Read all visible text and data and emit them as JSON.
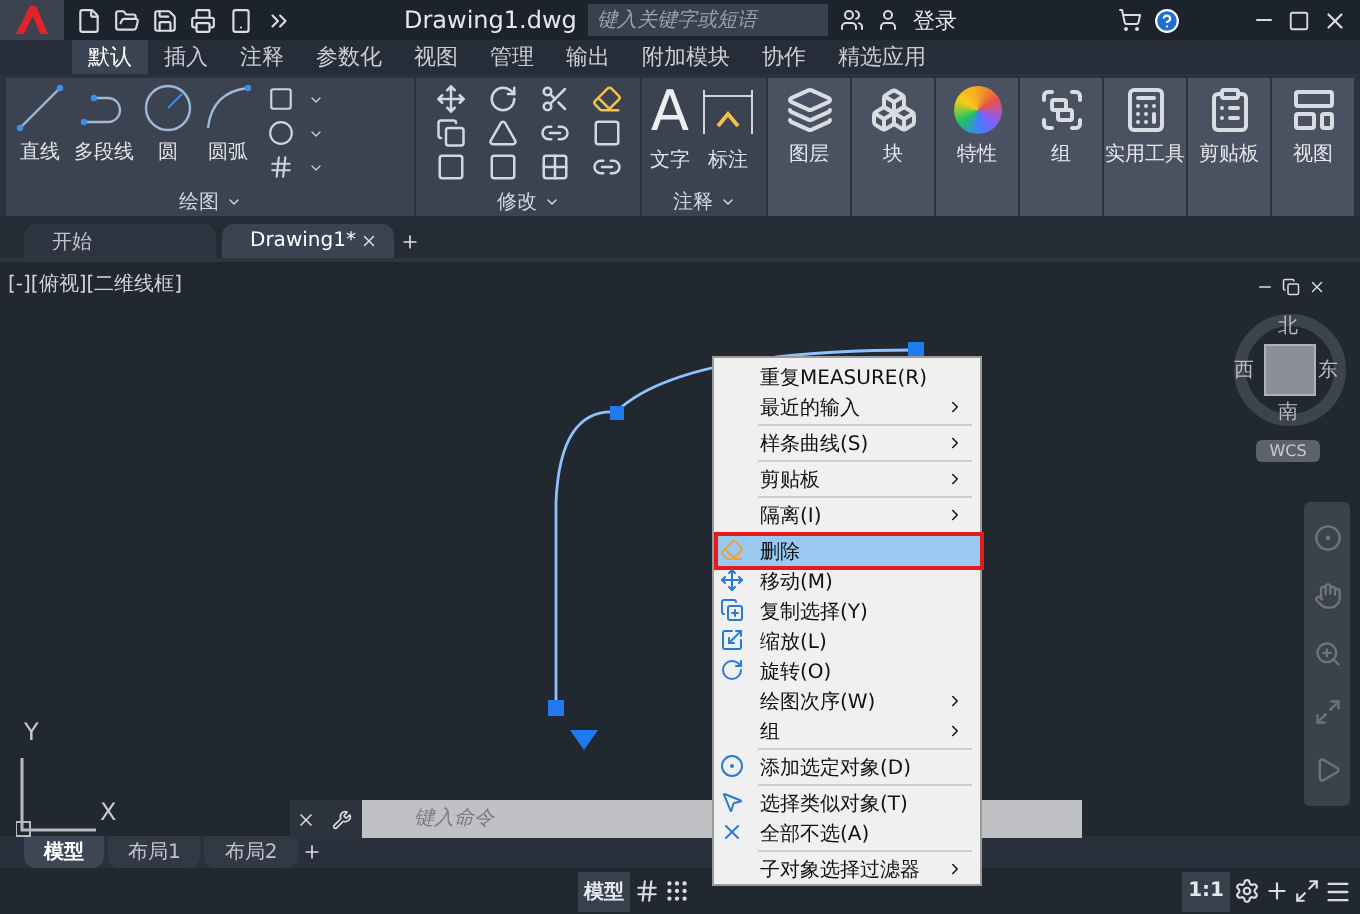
{
  "title_bar": {
    "title": "Drawing1.dwg",
    "search": {
      "placeholder": "键入关键字或短语"
    },
    "sign_in": "登录"
  },
  "ribbon_tabs": [
    {
      "label": "默认",
      "selected": true
    },
    {
      "label": "插入",
      "selected": false
    },
    {
      "label": "注释",
      "selected": false
    },
    {
      "label": "参数化",
      "selected": false
    },
    {
      "label": "视图",
      "selected": false
    },
    {
      "label": "管理",
      "selected": false
    },
    {
      "label": "输出",
      "selected": false
    },
    {
      "label": "附加模块",
      "selected": false
    },
    {
      "label": "协作",
      "selected": false
    },
    {
      "label": "精选应用",
      "selected": false
    }
  ],
  "ribbon_groups": [
    {
      "kind": "draw",
      "label": "绘图",
      "tools": [
        "直线",
        "多段线",
        "圆",
        "圆弧"
      ]
    },
    {
      "kind": "modify",
      "label": "修改"
    },
    {
      "kind": "annotate",
      "label": "注释",
      "icon_glyph": "A",
      "tools": [
        "文字",
        "标注"
      ]
    }
  ],
  "ribbon_buttons": [
    "图层",
    "块",
    "特性",
    "组",
    "实用工具",
    "剪贴板",
    "视图"
  ],
  "file_tabs": [
    {
      "label": "开始",
      "selected": false
    },
    {
      "label": "Drawing1*",
      "selected": true
    }
  ],
  "viewport": {
    "label": "[-][俯视][二维线框]",
    "compass": {
      "north": "北",
      "south": "南",
      "east": "东",
      "west": "西"
    },
    "ucs_menu": "WCS",
    "axis_x": "X",
    "axis_y": "Y"
  },
  "context_menu": [
    {
      "kind": "command",
      "label": "重复MEASURE(R)",
      "selected": false
    },
    {
      "kind": "submenu",
      "label": "最近的输入",
      "selected": false
    },
    {
      "kind": "separator"
    },
    {
      "kind": "submenu",
      "label": "样条曲线(S)",
      "selected": false
    },
    {
      "kind": "separator"
    },
    {
      "kind": "submenu",
      "label": "剪贴板",
      "selected": false
    },
    {
      "kind": "separator"
    },
    {
      "kind": "submenu",
      "label": "隔离(I)",
      "selected": false
    },
    {
      "kind": "separator"
    },
    {
      "kind": "command",
      "label": "删除",
      "selected": true
    },
    {
      "kind": "command",
      "label": "移动(M)",
      "selected": false
    },
    {
      "kind": "command",
      "label": "复制选择(Y)",
      "selected": false
    },
    {
      "kind": "command",
      "label": "缩放(L)",
      "selected": false
    },
    {
      "kind": "command",
      "label": "旋转(O)",
      "selected": false
    },
    {
      "kind": "submenu",
      "label": "绘图次序(W)",
      "selected": false
    },
    {
      "kind": "submenu",
      "label": "组",
      "selected": false
    },
    {
      "kind": "separator"
    },
    {
      "kind": "command",
      "label": "添加选定对象(D)",
      "selected": false
    },
    {
      "kind": "separator"
    },
    {
      "kind": "command",
      "label": "选择类似对象(T)",
      "selected": false
    },
    {
      "kind": "command",
      "label": "全部不选(A)",
      "selected": false
    },
    {
      "kind": "separator"
    },
    {
      "kind": "submenu",
      "label": "子对象选择过滤器",
      "selected": false
    }
  ],
  "command_line": {
    "placeholder": "键入命令"
  },
  "layout_tabs": [
    {
      "label": "模型",
      "selected": true
    },
    {
      "label": "布局1",
      "selected": false
    },
    {
      "label": "布局2",
      "selected": false
    }
  ],
  "status_bar": {
    "space": "模型",
    "scale": "1:1"
  }
}
